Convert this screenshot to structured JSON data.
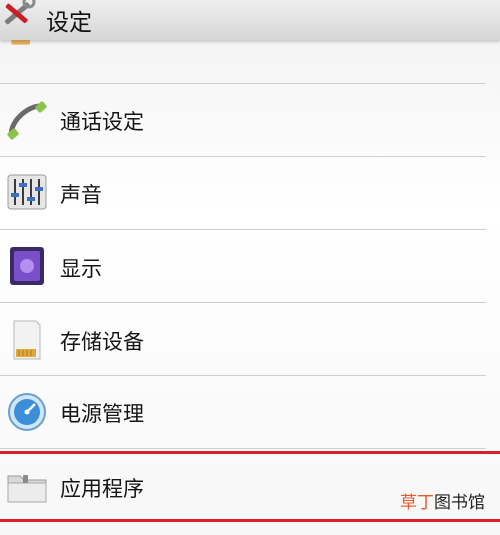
{
  "header": {
    "title": "设定",
    "icon": "tools-icon"
  },
  "list": {
    "items": [
      {
        "label": "",
        "icon": "folder-partial-icon"
      },
      {
        "label": "通话设定",
        "icon": "phone-handset-icon"
      },
      {
        "label": "声音",
        "icon": "equalizer-sliders-icon"
      },
      {
        "label": "显示",
        "icon": "display-screen-icon"
      },
      {
        "label": "存储设备",
        "icon": "sd-card-icon"
      },
      {
        "label": "电源管理",
        "icon": "power-gauge-icon"
      },
      {
        "label": "应用程序",
        "icon": "folder-icon"
      }
    ]
  },
  "highlight_color": "#d7202b",
  "watermark": {
    "accent": "草丁",
    "rest": "图书馆"
  }
}
